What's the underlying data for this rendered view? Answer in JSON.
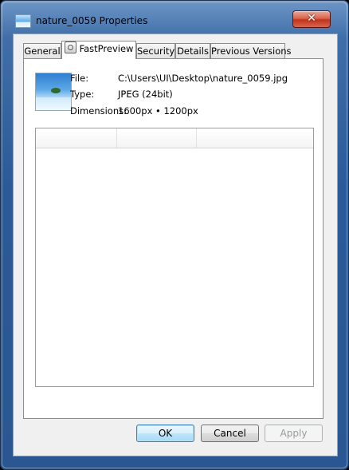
{
  "window": {
    "title": "nature_0059 Properties",
    "close_glyph": "✕"
  },
  "tabs": [
    {
      "label": "General",
      "active": false
    },
    {
      "label": "FastPreview",
      "active": true
    },
    {
      "label": "Security",
      "active": false
    },
    {
      "label": "Details",
      "active": false
    },
    {
      "label": "Previous Versions",
      "active": false
    }
  ],
  "info": {
    "file_label": "File:",
    "file_value": "C:\\Users\\UI\\Desktop\\nature_0059.jpg",
    "type_label": "Type:",
    "type_value": "JPEG (24bit)",
    "dimensions_label": "Dimensions:",
    "dimensions_value": "1600px • 1200px"
  },
  "listview": {
    "columns": [
      "",
      "",
      ""
    ]
  },
  "buttons": {
    "ok": "OK",
    "cancel": "Cancel",
    "apply": "Apply"
  },
  "colors": {
    "frame": "#2a5a98",
    "client": "#f0f0f0",
    "close": "#c1331c"
  }
}
